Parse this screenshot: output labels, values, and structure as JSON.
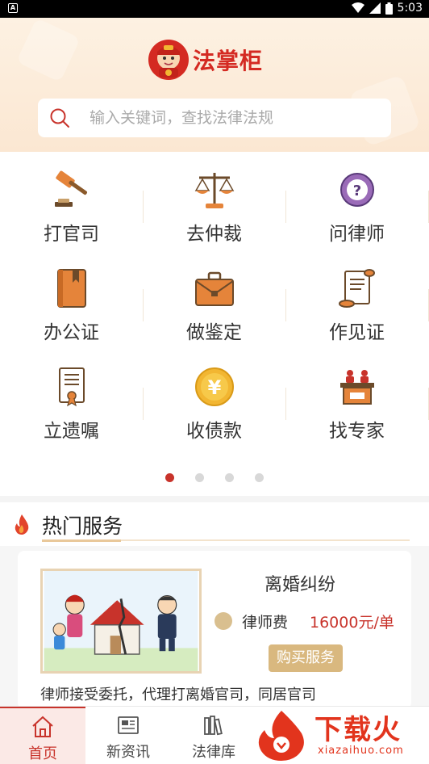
{
  "status_bar": {
    "time": "5:03",
    "left_badge": "A"
  },
  "header": {
    "logo_text": "法掌柜",
    "search_placeholder": "输入关键词，查找法律法规"
  },
  "services_grid": [
    {
      "label": "打官司",
      "icon": "gavel-icon"
    },
    {
      "label": "去仲裁",
      "icon": "scales-icon"
    },
    {
      "label": "问律师",
      "icon": "question-icon"
    },
    {
      "label": "办公证",
      "icon": "book-icon"
    },
    {
      "label": "做鉴定",
      "icon": "briefcase-icon"
    },
    {
      "label": "作见证",
      "icon": "scroll-icon"
    },
    {
      "label": "立遗嘱",
      "icon": "document-icon"
    },
    {
      "label": "收债款",
      "icon": "yen-coin-icon"
    },
    {
      "label": "找专家",
      "icon": "podium-icon"
    }
  ],
  "carousel": {
    "pages": 4,
    "active_index": 0
  },
  "hot_services": {
    "title": "热门服务",
    "card": {
      "title": "离婚纠纷",
      "fee_label": "律师费",
      "fee_value": "16000元/单",
      "buy_label": "购买服务",
      "description": "律师接受委托，代理打离婚官司，同居官司"
    }
  },
  "tabs": [
    {
      "label": "首页",
      "icon": "home-icon",
      "active": true
    },
    {
      "label": "新资讯",
      "icon": "newspaper-icon",
      "active": false
    },
    {
      "label": "法律库",
      "icon": "books-icon",
      "active": false
    }
  ],
  "watermark": {
    "main": "下载火",
    "sub": "xiazaihuo.com"
  },
  "colors": {
    "accent": "#c8332b",
    "gold": "#d9b87f",
    "header_bg": "#fbe7d2"
  }
}
